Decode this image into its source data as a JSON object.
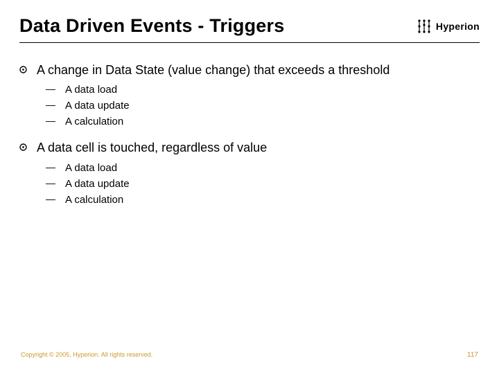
{
  "title": "Data Driven Events - Triggers",
  "brand": {
    "name": "Hyperion"
  },
  "bullets": [
    {
      "text": "A change in Data State (value change) that exceeds a threshold",
      "subs": [
        "A data load",
        "A data update",
        "A calculation"
      ]
    },
    {
      "text": "A data cell is touched, regardless of value",
      "subs": [
        "A data load",
        "A data update",
        "A calculation"
      ]
    }
  ],
  "footer": {
    "copyright": "Copyright © 2005, Hyperion. All rights reserved.",
    "page": "117"
  },
  "colors": {
    "accent": "#c99a2e"
  }
}
